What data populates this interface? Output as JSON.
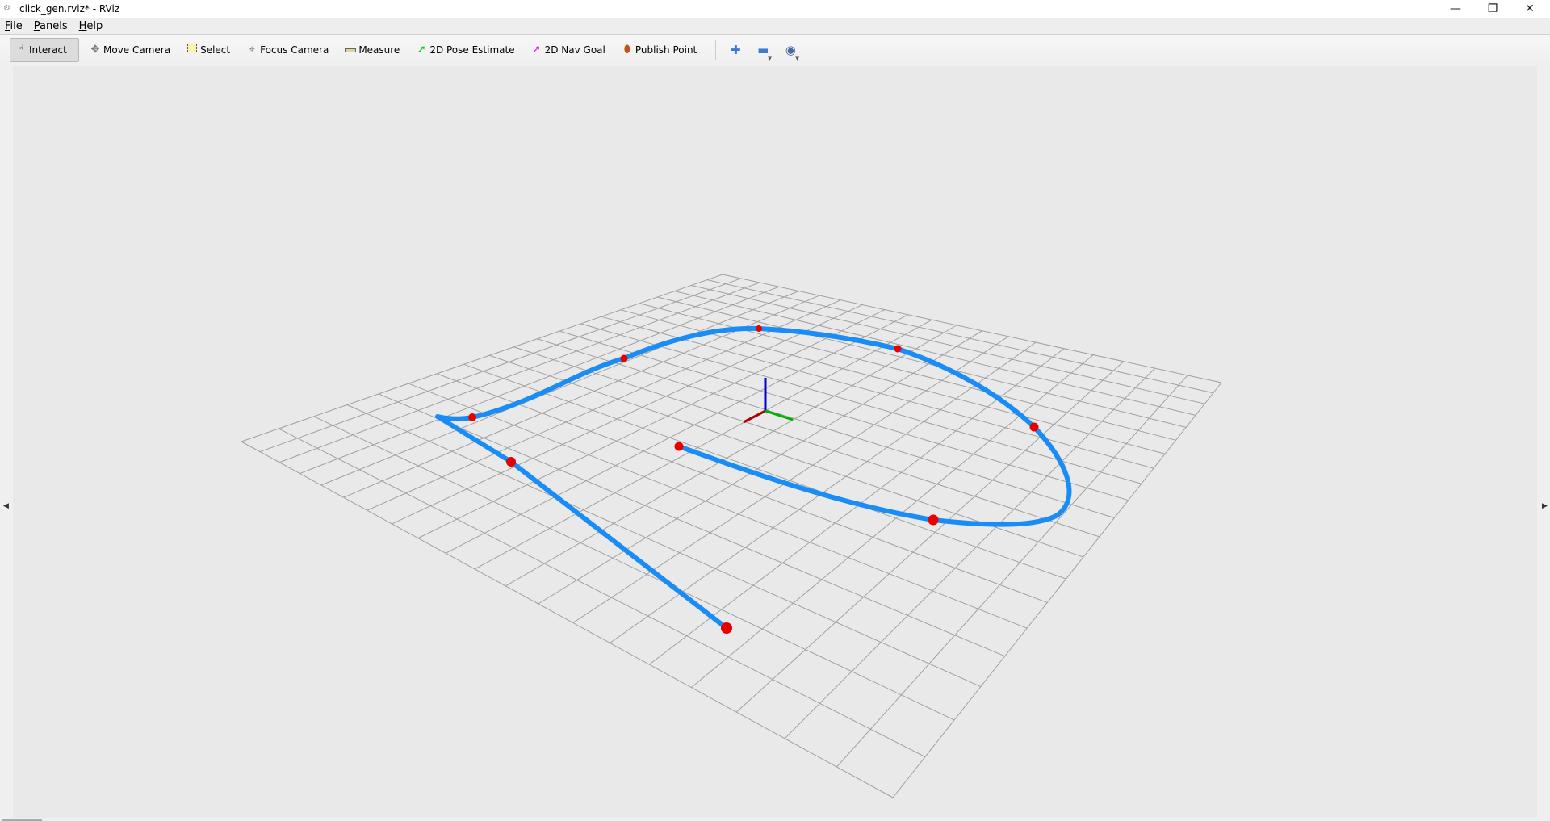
{
  "window": {
    "title": "click_gen.rviz* - RViz"
  },
  "menu": [
    "File",
    "Panels",
    "Help"
  ],
  "toolbar": {
    "tools": [
      {
        "label": "Interact",
        "icon": "hand-icon",
        "active": true
      },
      {
        "label": "Move Camera",
        "icon": "move-camera-icon"
      },
      {
        "label": "Select",
        "icon": "select-icon"
      },
      {
        "label": "Focus Camera",
        "icon": "focus-camera-icon"
      },
      {
        "label": "Measure",
        "icon": "ruler-icon"
      },
      {
        "label": "2D Pose Estimate",
        "icon": "green-arrow-icon"
      },
      {
        "label": "2D Nav Goal",
        "icon": "magenta-arrow-icon"
      },
      {
        "label": "Publish Point",
        "icon": "map-pin-icon"
      }
    ]
  },
  "colors": {
    "path": "#1a8cf5",
    "points": "#e60000",
    "grid": "#a0a0a0",
    "x_axis": "#b00000",
    "y_axis": "#00b000",
    "z_axis": "#0000d0"
  }
}
